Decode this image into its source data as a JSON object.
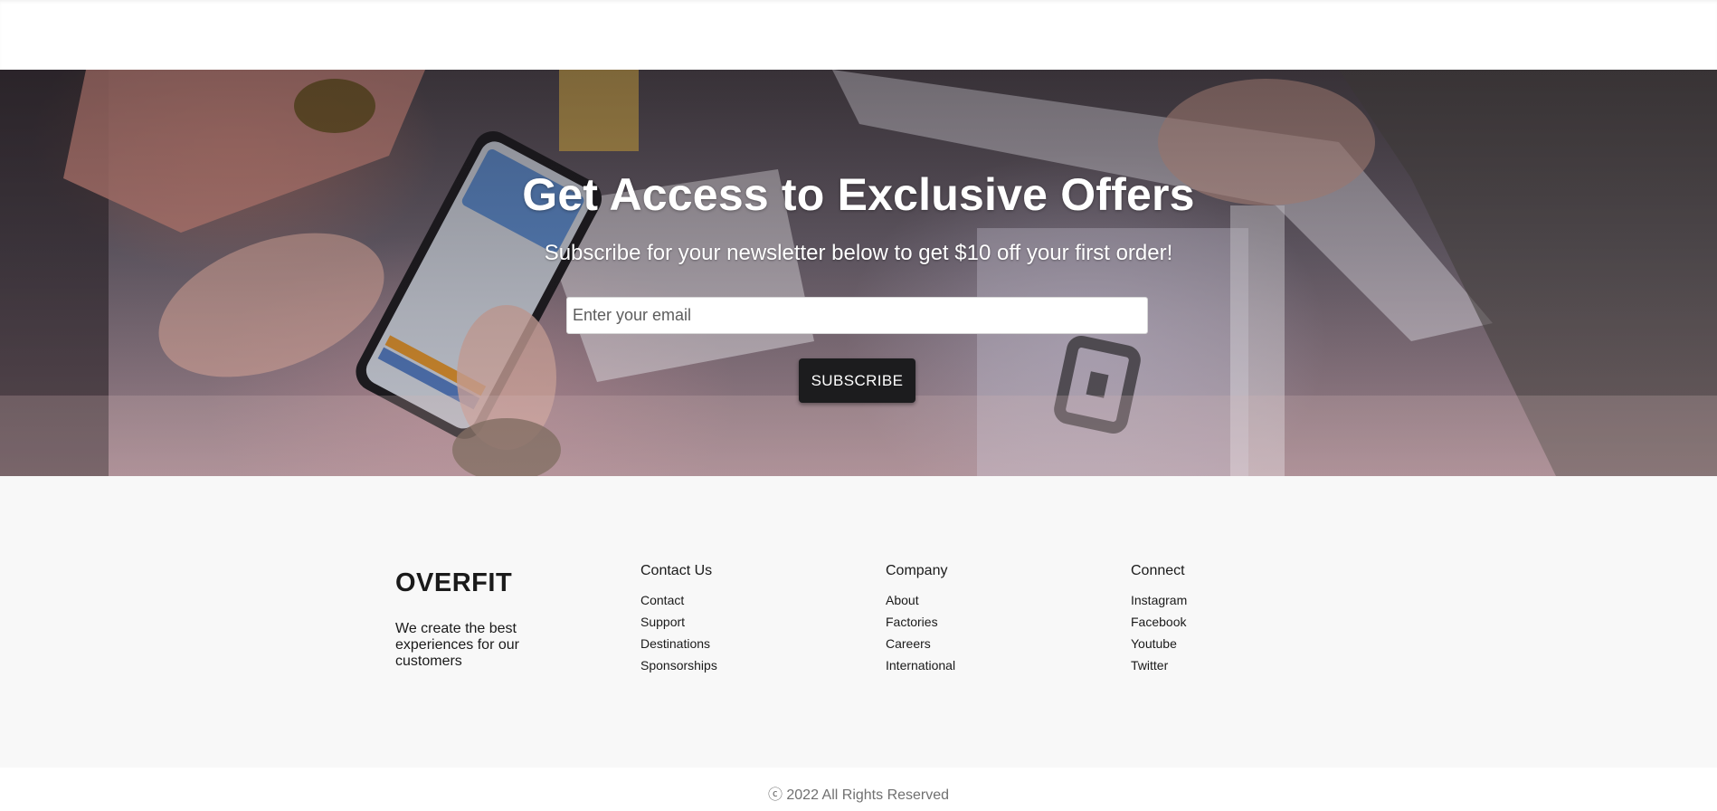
{
  "hero": {
    "title": "Get Access to Exclusive Offers",
    "subtitle": "Subscribe for your newsletter below to get $10 off your first order!",
    "email_placeholder": "Enter your email",
    "email_value": "",
    "subscribe_label": "SUBSCRIBE"
  },
  "footer": {
    "brand": "OVERFIT",
    "tagline": "We create the best experiences for our customers",
    "columns": [
      {
        "title": "Contact Us",
        "links": [
          "Contact",
          "Support",
          "Destinations",
          "Sponsorships"
        ]
      },
      {
        "title": "Company",
        "links": [
          "About",
          "Factories",
          "Careers",
          "International"
        ]
      },
      {
        "title": "Connect",
        "links": [
          "Instagram",
          "Facebook",
          "Youtube",
          "Twitter"
        ]
      }
    ],
    "copyright": "ⓒ 2022 All Rights Reserved"
  },
  "colors": {
    "button_bg": "#1c1c1e",
    "footer_bg": "#f8f8f8",
    "text_dark": "#1a1a1a",
    "copyright_text": "#707070"
  }
}
